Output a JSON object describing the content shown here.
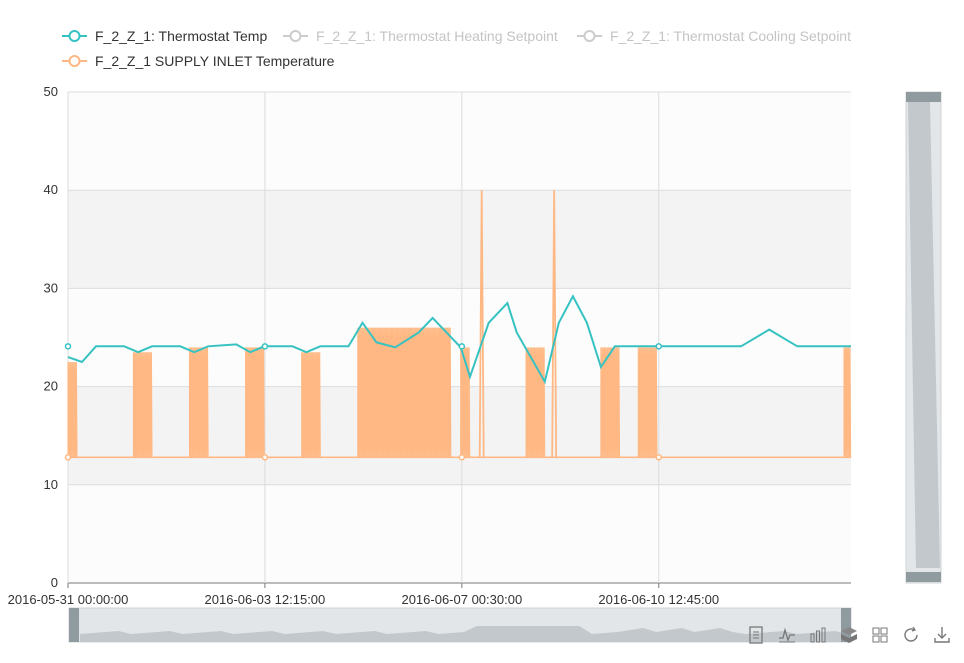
{
  "chart_data": {
    "type": "line",
    "x_axis": {
      "kind": "time",
      "min": "2016-05-31 00:00:00",
      "max": "2016-06-13 23:00:00",
      "tick_labels": [
        "2016-05-31 00:00:00",
        "2016-06-03 12:15:00",
        "2016-06-07 00:30:00",
        "2016-06-10 12:45:00"
      ]
    },
    "y_axis": {
      "min": 0,
      "max": 50,
      "ticks": [
        0,
        10,
        20,
        30,
        40,
        50
      ]
    },
    "grid": true,
    "legend": {
      "placement": "top-left"
    },
    "series": [
      {
        "name": "F_2_Z_1: Thermostat Temp",
        "color": "#37c2c2",
        "visible": true,
        "points": [
          [
            "2016-05-31 00:00:00",
            23.0
          ],
          [
            "2016-05-31 06:00:00",
            22.5
          ],
          [
            "2016-05-31 12:00:00",
            24.1
          ],
          [
            "2016-06-01 00:00:00",
            24.1
          ],
          [
            "2016-06-01 06:00:00",
            23.5
          ],
          [
            "2016-06-01 12:00:00",
            24.1
          ],
          [
            "2016-06-02 00:00:00",
            24.1
          ],
          [
            "2016-06-02 06:00:00",
            23.5
          ],
          [
            "2016-06-02 12:00:00",
            24.1
          ],
          [
            "2016-06-03 00:00:00",
            24.3
          ],
          [
            "2016-06-03 06:00:00",
            23.5
          ],
          [
            "2016-06-03 12:00:00",
            24.1
          ],
          [
            "2016-06-04 00:00:00",
            24.1
          ],
          [
            "2016-06-04 06:00:00",
            23.5
          ],
          [
            "2016-06-04 12:00:00",
            24.1
          ],
          [
            "2016-06-05 00:00:00",
            24.1
          ],
          [
            "2016-06-05 06:00:00",
            26.5
          ],
          [
            "2016-06-05 12:00:00",
            24.5
          ],
          [
            "2016-06-05 20:00:00",
            24.0
          ],
          [
            "2016-06-06 06:00:00",
            25.5
          ],
          [
            "2016-06-06 12:00:00",
            27.0
          ],
          [
            "2016-06-07 00:00:00",
            24.0
          ],
          [
            "2016-06-07 04:00:00",
            21.0
          ],
          [
            "2016-06-07 12:00:00",
            26.5
          ],
          [
            "2016-06-07 20:00:00",
            28.5
          ],
          [
            "2016-06-08 00:00:00",
            25.5
          ],
          [
            "2016-06-08 12:00:00",
            20.5
          ],
          [
            "2016-06-08 18:00:00",
            26.5
          ],
          [
            "2016-06-09 00:00:00",
            29.2
          ],
          [
            "2016-06-09 06:00:00",
            26.5
          ],
          [
            "2016-06-09 12:00:00",
            22.0
          ],
          [
            "2016-06-09 18:00:00",
            24.1
          ],
          [
            "2016-06-10 06:00:00",
            24.1
          ],
          [
            "2016-06-10 12:00:00",
            24.1
          ],
          [
            "2016-06-11 00:00:00",
            24.1
          ],
          [
            "2016-06-12 00:00:00",
            24.1
          ],
          [
            "2016-06-12 12:00:00",
            25.8
          ],
          [
            "2016-06-13 00:00:00",
            24.1
          ],
          [
            "2016-06-13 23:00:00",
            24.1
          ]
        ]
      },
      {
        "name": "F_2_Z_1: Thermostat Heating Setpoint",
        "color": "#c8c8c8",
        "visible": false,
        "points": []
      },
      {
        "name": "F_2_Z_1: Thermostat Cooling Setpoint",
        "color": "#c8c8c8",
        "visible": false,
        "points": []
      },
      {
        "name": "F_2_Z_1 SUPPLY INLET Temperature",
        "color": "#ffb883",
        "visible": true,
        "occupied_periods": [
          {
            "start": "2016-05-31 00:00:00",
            "end": "2016-05-31 04:00:00",
            "top": 22.5
          },
          {
            "start": "2016-06-01 04:00:00",
            "end": "2016-06-01 12:00:00",
            "top": 23.5
          },
          {
            "start": "2016-06-02 04:00:00",
            "end": "2016-06-02 12:00:00",
            "top": 24.0
          },
          {
            "start": "2016-06-03 04:00:00",
            "end": "2016-06-03 12:00:00",
            "top": 24.0
          },
          {
            "start": "2016-06-04 04:00:00",
            "end": "2016-06-04 12:00:00",
            "top": 23.5
          },
          {
            "start": "2016-06-05 04:00:00",
            "end": "2016-06-06 20:00:00",
            "top": 26.0
          },
          {
            "start": "2016-06-07 00:00:00",
            "end": "2016-06-07 04:00:00",
            "top": 24.0
          },
          {
            "start": "2016-06-08 04:00:00",
            "end": "2016-06-08 12:00:00",
            "top": 24.0
          },
          {
            "start": "2016-06-09 12:00:00",
            "end": "2016-06-09 20:00:00",
            "top": 24.0
          },
          {
            "start": "2016-06-10 04:00:00",
            "end": "2016-06-10 12:00:00",
            "top": 24.0
          },
          {
            "start": "2016-06-13 20:00:00",
            "end": "2016-06-13 23:00:00",
            "top": 24.0
          }
        ],
        "baseline": 12.8,
        "spikes": [
          {
            "time": "2016-06-07 09:00:00",
            "value": 40.0
          },
          {
            "time": "2016-06-08 16:00:00",
            "value": 40.0
          }
        ]
      }
    ]
  },
  "toolbar": {
    "icons": [
      "data-view-icon",
      "line-chart-icon",
      "bar-chart-icon",
      "stack-icon",
      "tiled-icon",
      "restore-icon",
      "save-image-icon"
    ]
  }
}
